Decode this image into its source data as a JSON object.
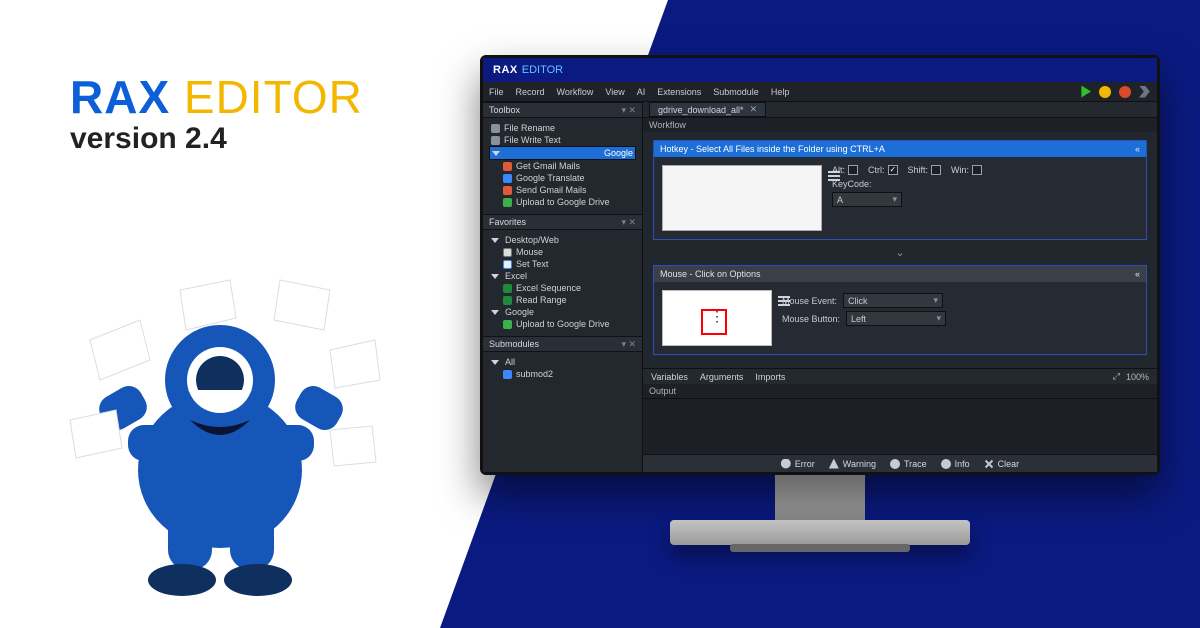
{
  "brand": {
    "rax": "RAX",
    "editor": "EDITOR",
    "version": "version 2.4"
  },
  "titlebar": {
    "rax": "RAX",
    "editor": "EDITOR"
  },
  "menu": [
    "File",
    "Record",
    "Workflow",
    "View",
    "AI",
    "Extensions",
    "Submodule",
    "Help"
  ],
  "run": {
    "play": "play-icon",
    "build": "build-icon",
    "stop": "stop-icon",
    "step": "step-icon"
  },
  "panels": {
    "toolbox": {
      "title": "Toolbox",
      "items": [
        {
          "icon": "file",
          "label": "File Rename"
        },
        {
          "icon": "file",
          "label": "File Write Text"
        }
      ],
      "google_header": "Google",
      "google_items": [
        {
          "icon": "mail",
          "label": "Get Gmail Mails"
        },
        {
          "icon": "gt",
          "label": "Google Translate"
        },
        {
          "icon": "mail",
          "label": "Send Gmail Mails"
        },
        {
          "icon": "up",
          "label": "Upload to Google Drive"
        }
      ]
    },
    "favorites": {
      "title": "Favorites",
      "groups": [
        {
          "name": "Desktop/Web",
          "items": [
            {
              "icon": "mouse",
              "label": "Mouse"
            },
            {
              "icon": "txt",
              "label": "Set Text"
            }
          ]
        },
        {
          "name": "Excel",
          "items": [
            {
              "icon": "xl",
              "label": "Excel Sequence"
            },
            {
              "icon": "xl",
              "label": "Read Range"
            }
          ]
        },
        {
          "name": "Google",
          "items": [
            {
              "icon": "up",
              "label": "Upload to Google Drive"
            }
          ]
        }
      ]
    },
    "submodules": {
      "title": "Submodules",
      "root": "All",
      "items": [
        {
          "icon": "sub",
          "label": "submod2"
        }
      ]
    }
  },
  "tab": {
    "label": "gdrive_download_all*",
    "workflow_label": "Workflow"
  },
  "node_hotkey": {
    "title": "Hotkey - Select All Files inside the Folder using CTRL+A",
    "mods": {
      "alt_label": "Alt:",
      "ctrl_label": "Ctrl:",
      "shift_label": "Shift:",
      "win_label": "Win:",
      "alt": false,
      "ctrl": true,
      "shift": false,
      "win": false
    },
    "keycode_label": "KeyCode:",
    "keycode": "A"
  },
  "node_mouse": {
    "title": "Mouse - Click on Options",
    "event_label": "Mouse Event:",
    "event": "Click",
    "button_label": "Mouse Button:",
    "button": "Left"
  },
  "bottom_tabs": [
    "Variables",
    "Arguments",
    "Imports"
  ],
  "zoom": "100%",
  "output_label": "Output",
  "status": {
    "error": "Error",
    "warning": "Warning",
    "trace": "Trace",
    "info": "Info",
    "clear": "Clear"
  }
}
